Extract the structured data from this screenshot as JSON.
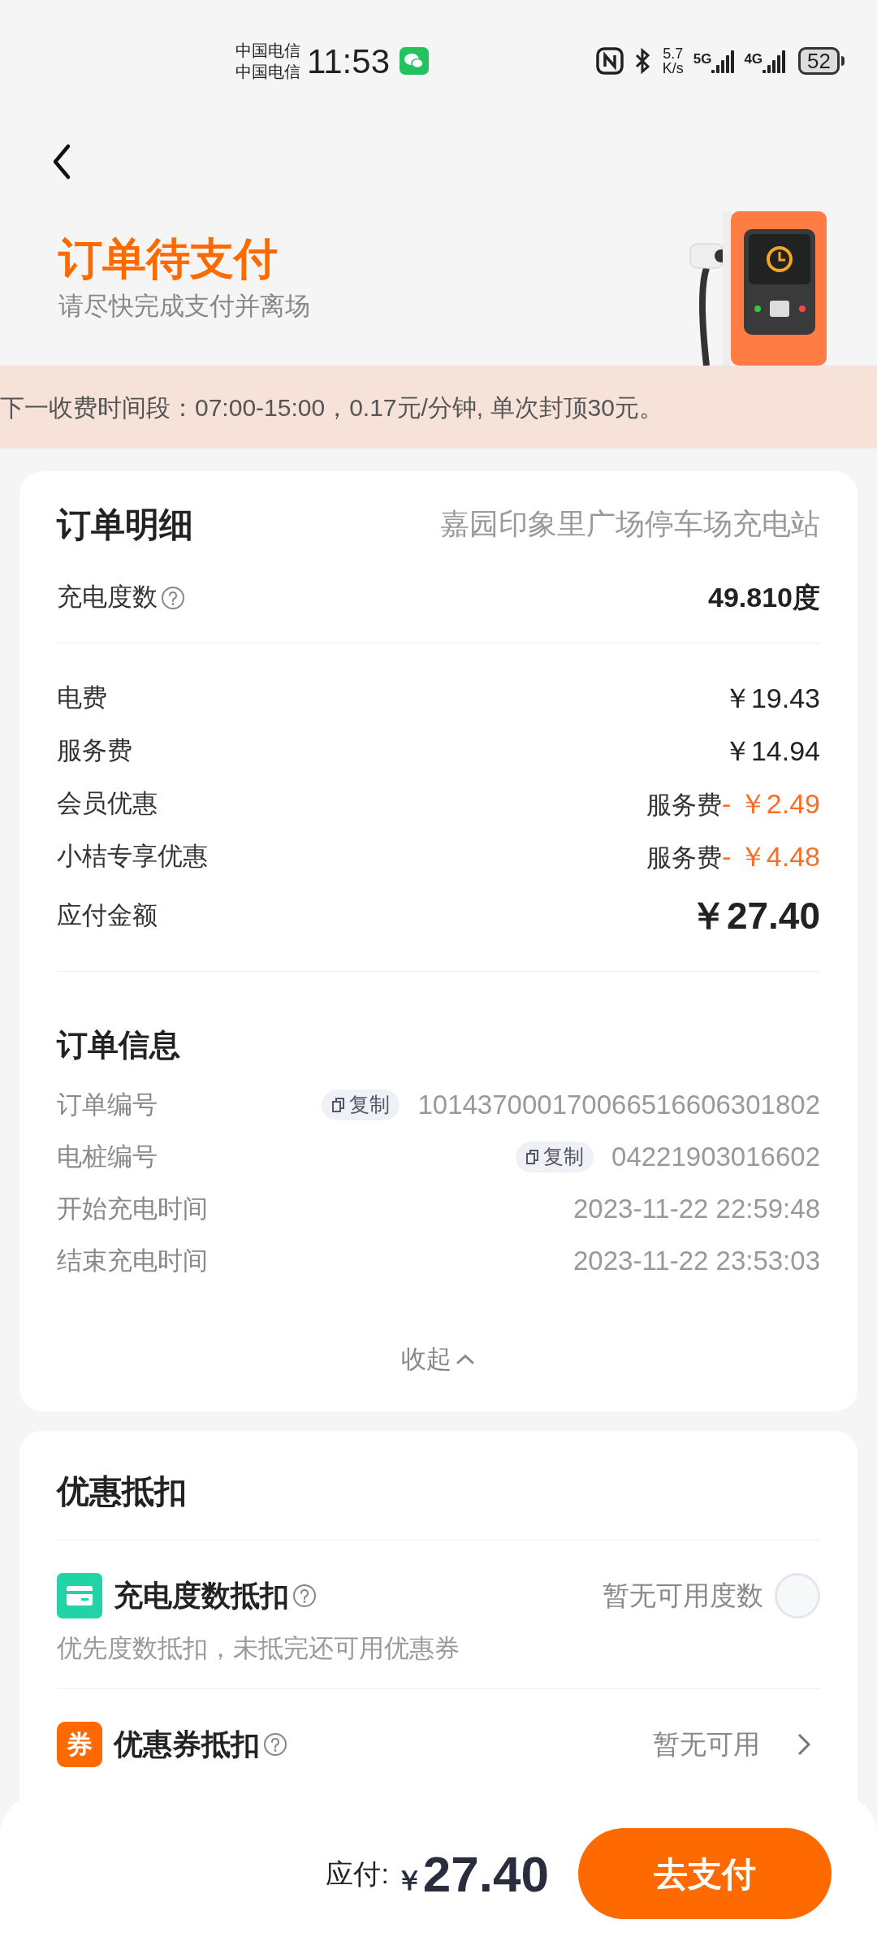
{
  "status_bar": {
    "carriers": [
      "中国电信",
      "中国电信"
    ],
    "time": "11:53",
    "speed_value": "5.7",
    "speed_unit": "K/s",
    "networks": [
      "5G",
      "4G"
    ],
    "battery": "52"
  },
  "header": {
    "title": "订单待支付",
    "subtitle": "请尽快完成支付并离场"
  },
  "notice": "下一收费时间段：07:00-15:00，0.17元/分钟, 单次封顶30元。",
  "order_detail": {
    "title": "订单明细",
    "station": "嘉园印象里广场停车场充电站",
    "energy": {
      "label": "充电度数",
      "value": "49.810度"
    },
    "fees": [
      {
        "kind": "plain",
        "label": "电费",
        "value": "￥19.43"
      },
      {
        "kind": "plain",
        "label": "服务费",
        "value": "￥14.94"
      },
      {
        "kind": "discount",
        "label": "会员优惠",
        "prefix": "服务费",
        "value": "- ￥2.49"
      },
      {
        "kind": "discount",
        "label": "小桔专享优惠",
        "prefix": "服务费",
        "value": "- ￥4.48"
      },
      {
        "kind": "total",
        "label": "应付金额",
        "value": "￥27.40"
      }
    ]
  },
  "order_info": {
    "title": "订单信息",
    "rows": [
      {
        "label": "订单编号",
        "copy": "复制",
        "value": "101437000170066516606301802"
      },
      {
        "label": "电桩编号",
        "copy": "复制",
        "value": "04221903016602"
      },
      {
        "label": "开始充电时间",
        "value": "2023-11-22 22:59:48"
      },
      {
        "label": "结束充电时间",
        "value": "2023-11-22 23:53:03"
      }
    ],
    "collapse": "收起"
  },
  "discounts": {
    "title": "优惠抵扣",
    "items": [
      {
        "kind": "energy",
        "title": "充电度数抵扣",
        "status": "暂无可用度数",
        "checked": false,
        "note": "优先度数抵扣，未抵完还可用优惠券"
      },
      {
        "kind": "coupon",
        "icon_text": "券",
        "title": "优惠券抵扣",
        "status": "暂无可用"
      }
    ]
  },
  "footer": {
    "label": "应付:",
    "currency": "￥",
    "amount": "27.40",
    "pay_button": "去支付"
  }
}
